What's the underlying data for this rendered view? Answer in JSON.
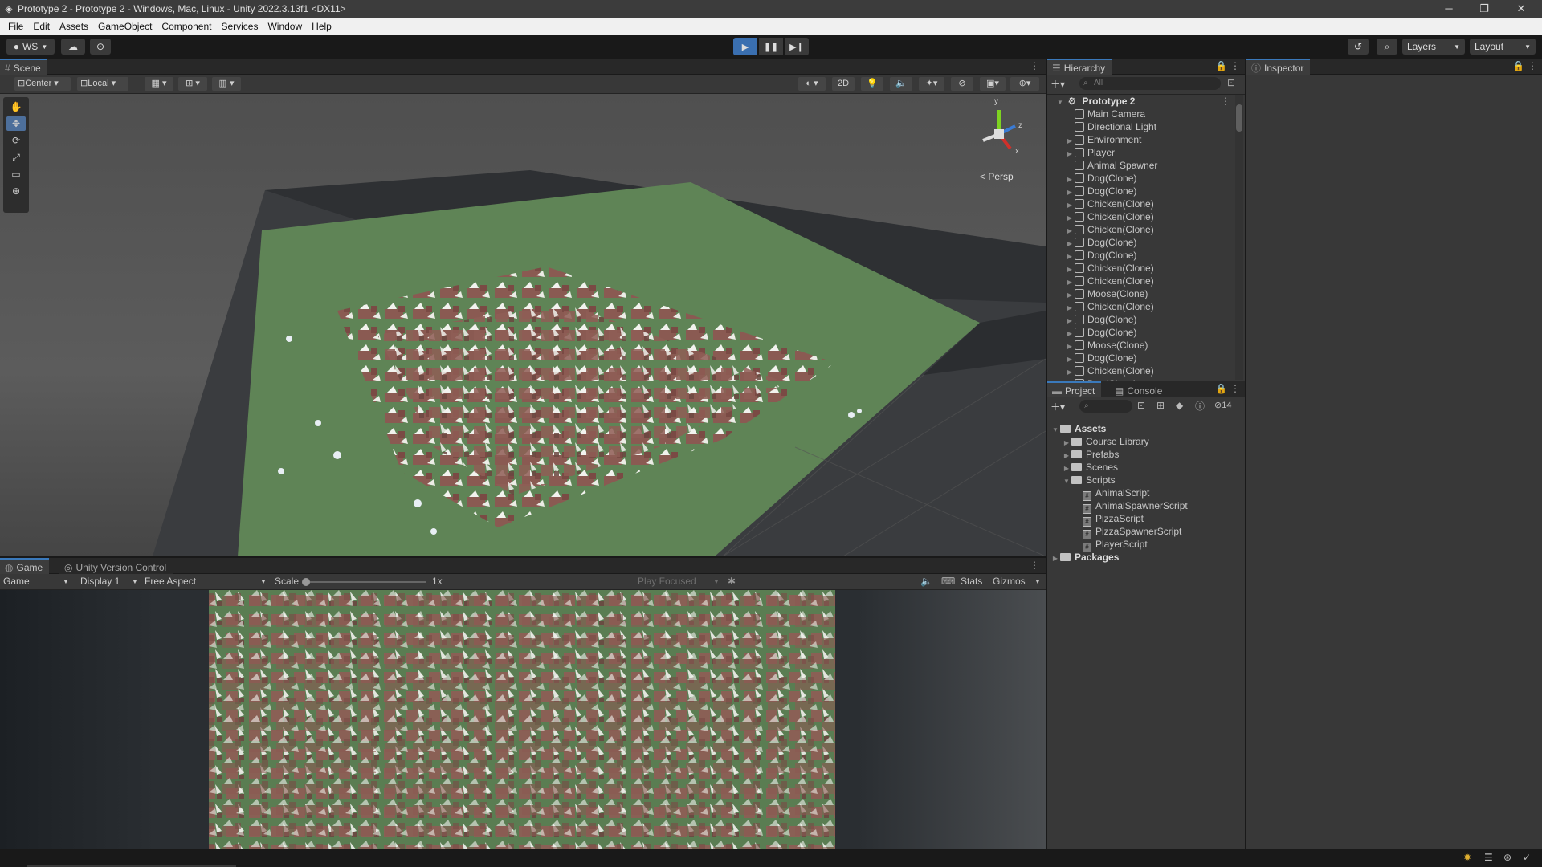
{
  "window": {
    "title": "Prototype 2 - Prototype 2 - Windows, Mac, Linux - Unity 2022.3.13f1 <DX11>",
    "minimize": "─",
    "restore": "❐",
    "close": "✕"
  },
  "menu": [
    "File",
    "Edit",
    "Assets",
    "GameObject",
    "Component",
    "Services",
    "Window",
    "Help"
  ],
  "toolbar": {
    "account": "WS",
    "layers": "Layers",
    "layout": "Layout"
  },
  "scene": {
    "tab": "Scene",
    "pivot": "Center",
    "space": "Local",
    "mode_2d": "2D",
    "persp": "Persp",
    "gizmo_y": "y",
    "gizmo_x": "x",
    "gizmo_z": "z"
  },
  "game": {
    "tab": "Game",
    "tab_vc": "Unity Version Control",
    "mode": "Game",
    "display": "Display 1",
    "aspect": "Free Aspect",
    "scale_label": "Scale",
    "scale_value": "1x",
    "play_focused": "Play Focused",
    "stats": "Stats",
    "gizmos": "Gizmos"
  },
  "hierarchy": {
    "tab": "Hierarchy",
    "search_placeholder": "All",
    "root": "Prototype 2",
    "items": [
      {
        "label": "Main Camera",
        "expand": false
      },
      {
        "label": "Directional Light",
        "expand": false
      },
      {
        "label": "Environment",
        "expand": true
      },
      {
        "label": "Player",
        "expand": true
      },
      {
        "label": "Animal Spawner",
        "expand": false
      },
      {
        "label": "Dog(Clone)",
        "expand": true
      },
      {
        "label": "Dog(Clone)",
        "expand": true
      },
      {
        "label": "Chicken(Clone)",
        "expand": true
      },
      {
        "label": "Chicken(Clone)",
        "expand": true
      },
      {
        "label": "Chicken(Clone)",
        "expand": true
      },
      {
        "label": "Dog(Clone)",
        "expand": true
      },
      {
        "label": "Dog(Clone)",
        "expand": true
      },
      {
        "label": "Chicken(Clone)",
        "expand": true
      },
      {
        "label": "Chicken(Clone)",
        "expand": true
      },
      {
        "label": "Moose(Clone)",
        "expand": true
      },
      {
        "label": "Chicken(Clone)",
        "expand": true
      },
      {
        "label": "Dog(Clone)",
        "expand": true
      },
      {
        "label": "Dog(Clone)",
        "expand": true
      },
      {
        "label": "Moose(Clone)",
        "expand": true
      },
      {
        "label": "Dog(Clone)",
        "expand": true
      },
      {
        "label": "Chicken(Clone)",
        "expand": true
      },
      {
        "label": "Dog(Clone)",
        "expand": true
      }
    ]
  },
  "inspector": {
    "tab": "Inspector"
  },
  "project": {
    "tab": "Project",
    "tab_console": "Console",
    "hidden_count": "14",
    "tree": [
      {
        "label": "Assets",
        "type": "folder",
        "level": 0,
        "arrow": "▼",
        "bold": true
      },
      {
        "label": "Course Library",
        "type": "folder",
        "level": 1,
        "arrow": "▶",
        "bold": false
      },
      {
        "label": "Prefabs",
        "type": "folder",
        "level": 1,
        "arrow": "▶",
        "bold": false
      },
      {
        "label": "Scenes",
        "type": "folder",
        "level": 1,
        "arrow": "▶",
        "bold": false
      },
      {
        "label": "Scripts",
        "type": "folder",
        "level": 1,
        "arrow": "▼",
        "bold": false
      },
      {
        "label": "AnimalScript",
        "type": "script",
        "level": 2,
        "arrow": "",
        "bold": false
      },
      {
        "label": "AnimalSpawnerScript",
        "type": "script",
        "level": 2,
        "arrow": "",
        "bold": false
      },
      {
        "label": "PizzaScript",
        "type": "script",
        "level": 2,
        "arrow": "",
        "bold": false
      },
      {
        "label": "PizzaSpawnerScript",
        "type": "script",
        "level": 2,
        "arrow": "",
        "bold": false
      },
      {
        "label": "PlayerScript",
        "type": "script",
        "level": 2,
        "arrow": "",
        "bold": false
      },
      {
        "label": "Packages",
        "type": "folder",
        "level": 0,
        "arrow": "▶",
        "bold": true
      }
    ]
  },
  "colors": {
    "accent": "#3a79bb",
    "play_active": "#3a6fb0",
    "ground": "#5f8456",
    "animal": "#8a5a52"
  }
}
